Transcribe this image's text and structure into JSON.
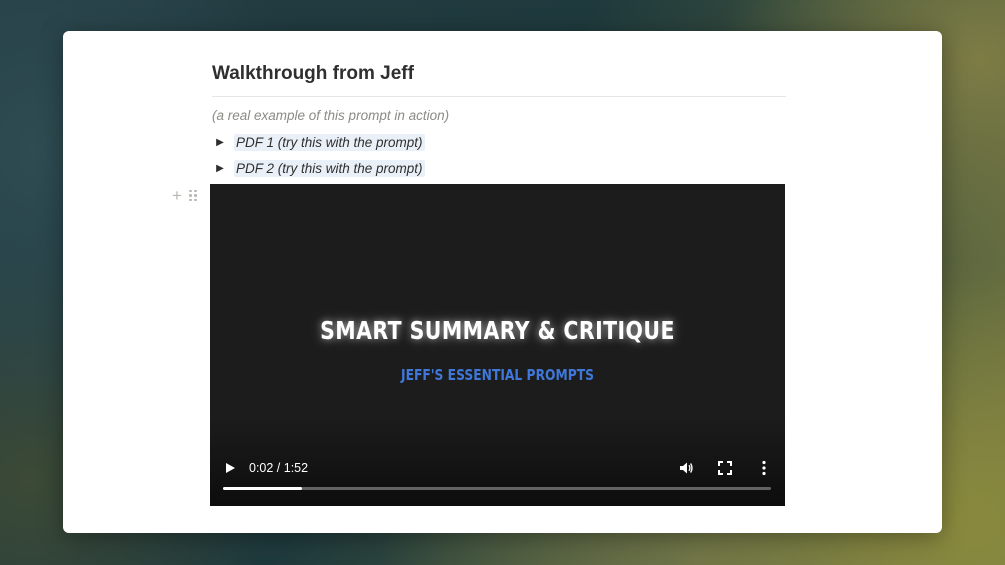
{
  "page": {
    "title": "Walkthrough from Jeff",
    "caption": "(a real example of this prompt in action)",
    "toggles": [
      {
        "label": "PDF 1 (try this with the prompt)",
        "icon": "triangle-right-icon"
      },
      {
        "label": "PDF 2 (try this with the prompt)",
        "icon": "triangle-right-icon"
      }
    ]
  },
  "video": {
    "title": "SMART SUMMARY & CRITIQUE",
    "subtitle": "JEFF'S ESSENTIAL PROMPTS",
    "subtitle_color": "#3f78d8",
    "time_display": "0:02 / 1:52",
    "progress_fraction": 0.145,
    "controls": [
      "play-icon",
      "volume-icon",
      "fullscreen-icon",
      "more-vertical-icon"
    ]
  },
  "block_handles": [
    "plus-icon",
    "drag-handle-icon"
  ]
}
